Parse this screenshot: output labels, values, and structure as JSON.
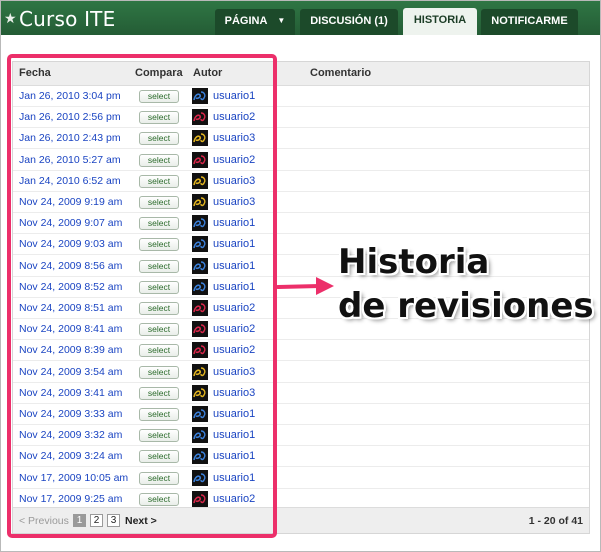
{
  "site": {
    "star": "★",
    "title": "Curso ITE"
  },
  "tabs": [
    {
      "label": "PÁGINA",
      "has_dropdown": true
    },
    {
      "label": "DISCUSIÓN (1)"
    },
    {
      "label": "HISTORIA",
      "active": true
    },
    {
      "label": "NOTIFICARME"
    }
  ],
  "table": {
    "headers": {
      "date": "Fecha",
      "compare": "Compara",
      "author": "Autor",
      "comment": "Comentario"
    },
    "select_label": "select",
    "rows": [
      {
        "date": "Jan 26, 2010 3:04 pm",
        "user": "usuario1",
        "avatar": "avatar-blue"
      },
      {
        "date": "Jan 26, 2010 2:56 pm",
        "user": "usuario2",
        "avatar": "avatar-red"
      },
      {
        "date": "Jan 26, 2010 2:43 pm",
        "user": "usuario3",
        "avatar": "avatar-yellow"
      },
      {
        "date": "Jan 26, 2010 5:27 am",
        "user": "usuario2",
        "avatar": "avatar-red"
      },
      {
        "date": "Jan 24, 2010 6:52 am",
        "user": "usuario3",
        "avatar": "avatar-yellow"
      },
      {
        "date": "Nov 24, 2009 9:19 am",
        "user": "usuario3",
        "avatar": "avatar-yellow"
      },
      {
        "date": "Nov 24, 2009 9:07 am",
        "user": "usuario1",
        "avatar": "avatar-blue"
      },
      {
        "date": "Nov 24, 2009 9:03 am",
        "user": "usuario1",
        "avatar": "avatar-blue"
      },
      {
        "date": "Nov 24, 2009 8:56 am",
        "user": "usuario1",
        "avatar": "avatar-blue"
      },
      {
        "date": "Nov 24, 2009 8:52 am",
        "user": "usuario1",
        "avatar": "avatar-blue"
      },
      {
        "date": "Nov 24, 2009 8:51 am",
        "user": "usuario2",
        "avatar": "avatar-red"
      },
      {
        "date": "Nov 24, 2009 8:41 am",
        "user": "usuario2",
        "avatar": "avatar-red"
      },
      {
        "date": "Nov 24, 2009 8:39 am",
        "user": "usuario2",
        "avatar": "avatar-red"
      },
      {
        "date": "Nov 24, 2009 3:54 am",
        "user": "usuario3",
        "avatar": "avatar-yellow"
      },
      {
        "date": "Nov 24, 2009 3:41 am",
        "user": "usuario3",
        "avatar": "avatar-yellow"
      },
      {
        "date": "Nov 24, 2009 3:33 am",
        "user": "usuario1",
        "avatar": "avatar-blue"
      },
      {
        "date": "Nov 24, 2009 3:32 am",
        "user": "usuario1",
        "avatar": "avatar-blue"
      },
      {
        "date": "Nov 24, 2009 3:24 am",
        "user": "usuario1",
        "avatar": "avatar-blue"
      },
      {
        "date": "Nov 17, 2009 10:05 am",
        "user": "usuario1",
        "avatar": "avatar-blue"
      },
      {
        "date": "Nov 17, 2009 9:25 am",
        "user": "usuario2",
        "avatar": "avatar-red"
      }
    ]
  },
  "pagination": {
    "previous": "< Previous",
    "pages": [
      "1",
      "2",
      "3"
    ],
    "current": "1",
    "next": "Next >",
    "range": "1 - 20 of 41"
  },
  "annotation": {
    "line1": "Historia",
    "line2": "de revisiones",
    "color": "#ec2f6a"
  },
  "colors": {
    "header_bg": "#2b6d3f",
    "tab_bg": "#1c4a2a",
    "active_tab_bg": "#eef3ee",
    "link": "#1a44c2",
    "highlight": "#ec2f6a"
  }
}
